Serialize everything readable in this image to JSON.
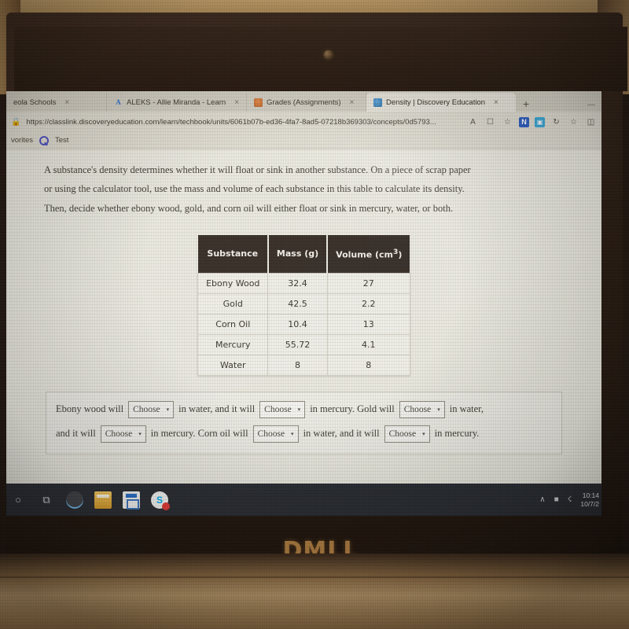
{
  "browser": {
    "tabs": [
      {
        "title": "eola Schools",
        "favicon": "none",
        "active": false
      },
      {
        "title": "ALEKS - Allie Miranda - Learn",
        "favicon": "aleks-a-icon",
        "active": false
      },
      {
        "title": "Grades (Assignments)",
        "favicon": "grades-icon",
        "active": false
      },
      {
        "title": "Density | Discovery Education",
        "favicon": "discovery-education-icon",
        "active": true
      }
    ],
    "new_tab_label": "+",
    "minimize_label": "—",
    "close_label": "×",
    "address": {
      "lock_icon": "lock-icon",
      "url": "https://classlink.discoveryeducation.com/learn/techbook/units/6061b07b-ed36-4fa7-8ad5-07218b369303/concepts/0d5793...",
      "read_aloud_label": "A",
      "toolbar_icons": [
        "immersive-reader-icon",
        "collections-icon",
        "nearpod-extension-icon",
        "screenshot-extension-icon",
        "history-icon",
        "favorites-add-icon",
        "split-screen-icon"
      ]
    },
    "bookmarks": [
      {
        "label": "vorites",
        "icon": "none"
      },
      {
        "label": "Test",
        "icon": "quizlet-q-icon"
      }
    ]
  },
  "page": {
    "prompt_lines": [
      "A substance's density determines whether it will float or sink in another substance. On a piece of scrap paper",
      "or using the calculator tool, use the mass and volume of each substance in this table to calculate its density.",
      "Then, decide whether ebony wood, gold, and corn oil will either float or sink in mercury, water, or both."
    ],
    "table": {
      "headers": [
        "Substance",
        "Mass (g)",
        "Volume (cm",
        "3",
        ")"
      ],
      "header_substance": "Substance",
      "header_mass": "Mass (g)",
      "header_volume_base": "Volume (cm",
      "header_volume_sup": "3",
      "header_volume_close": ")",
      "rows": [
        {
          "substance": "Ebony Wood",
          "mass": "32.4",
          "volume": "27"
        },
        {
          "substance": "Gold",
          "mass": "42.5",
          "volume": "2.2"
        },
        {
          "substance": "Corn Oil",
          "mass": "10.4",
          "volume": "13"
        },
        {
          "substance": "Mercury",
          "mass": "55.72",
          "volume": "4.1"
        },
        {
          "substance": "Water",
          "mass": "8",
          "volume": "8"
        }
      ]
    },
    "answer": {
      "dropdown_label": "Choose",
      "dropdown_caret": "▾",
      "line1": {
        "seg1": "Ebony wood will",
        "seg2": "in water, and it will",
        "seg3": "in mercury. Gold will",
        "seg4": "in water,"
      },
      "line2": {
        "seg1": "and it will",
        "seg2": "in mercury. Corn oil will",
        "seg3": "in water, and it will",
        "seg4": "in mercury."
      }
    }
  },
  "taskbar": {
    "items": [
      {
        "name": "cortana-icon",
        "glyph": "○"
      },
      {
        "name": "task-view-icon",
        "glyph": "⧉"
      },
      {
        "name": "edge-icon",
        "glyph": ""
      },
      {
        "name": "file-explorer-icon",
        "glyph": ""
      },
      {
        "name": "microsoft-store-icon",
        "glyph": ""
      },
      {
        "name": "skype-icon",
        "glyph": "S"
      }
    ],
    "tray": {
      "chevron": "∧",
      "battery_icon": "battery-icon",
      "network_icon": "network-icon",
      "time": "10:14",
      "date": "10/7/2"
    }
  },
  "device": {
    "brand": "DΜLL",
    "brand_plain": "DELL"
  }
}
